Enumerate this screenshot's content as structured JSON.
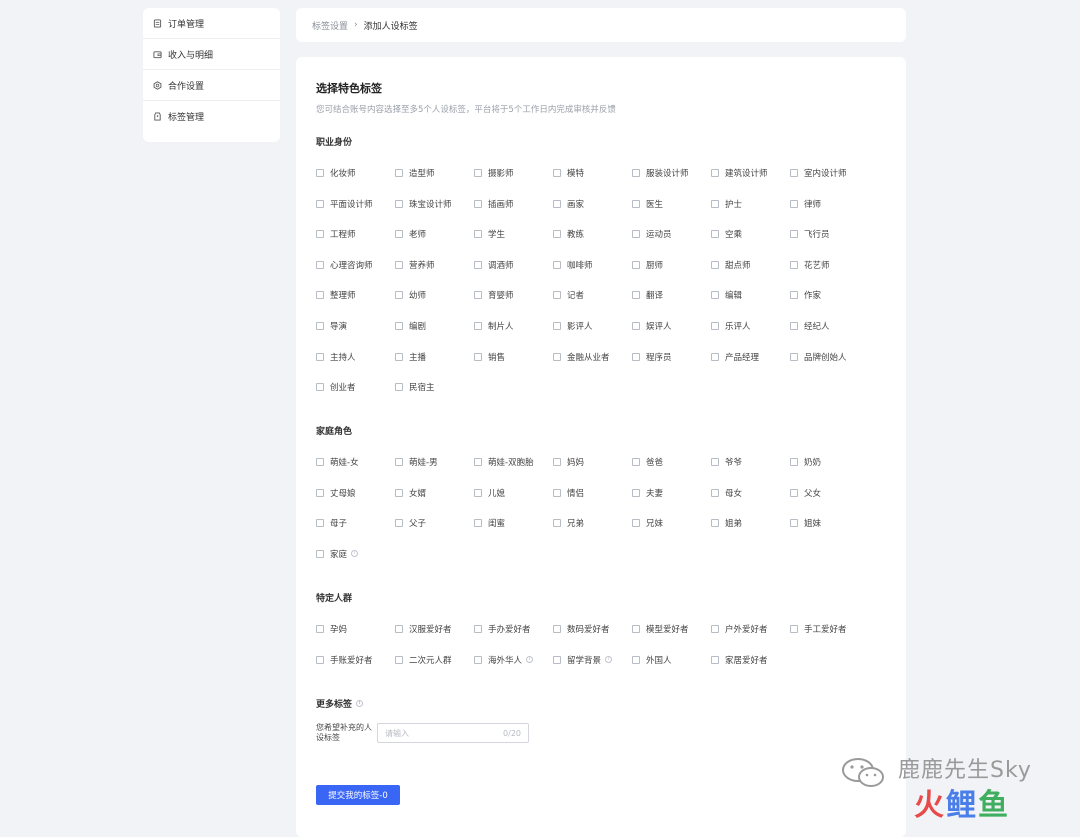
{
  "sidebar": {
    "items": [
      {
        "label": "订单管理",
        "icon": "order-icon"
      },
      {
        "label": "收入与明细",
        "icon": "wallet-icon"
      },
      {
        "label": "合作设置",
        "icon": "settings-icon"
      },
      {
        "label": "标签管理",
        "icon": "tag-icon"
      }
    ]
  },
  "breadcrumb": {
    "parent": "标签设置",
    "separator": "›",
    "current": "添加人设标签"
  },
  "main": {
    "title": "选择特色标签",
    "description": "您可结合账号内容选择至多5个人设标签，平台将于5个工作日内完成审核并反馈",
    "sections": [
      {
        "title": "职业身份",
        "options": [
          "化妆师",
          "造型师",
          "摄影师",
          "模特",
          "服装设计师",
          "建筑设计师",
          "室内设计师",
          "平面设计师",
          "珠宝设计师",
          "插画师",
          "画家",
          "医生",
          "护士",
          "律师",
          "工程师",
          "老师",
          "学生",
          "教练",
          "运动员",
          "空乘",
          "飞行员",
          "心理咨询师",
          "营养师",
          "调酒师",
          "咖啡师",
          "厨师",
          "甜点师",
          "花艺师",
          "整理师",
          "幼师",
          "育婴师",
          "记者",
          "翻译",
          "编辑",
          "作家",
          "导演",
          "编剧",
          "制片人",
          "影评人",
          "娱评人",
          "乐评人",
          "经纪人",
          "主持人",
          "主播",
          "销售",
          "金融从业者",
          "程序员",
          "产品经理",
          "品牌创始人",
          "创业者",
          "民宿主"
        ]
      },
      {
        "title": "家庭角色",
        "options": [
          "萌娃-女",
          "萌娃-男",
          "萌娃-双胞胎",
          "妈妈",
          "爸爸",
          "爷爷",
          "奶奶",
          "丈母娘",
          "女婿",
          "儿媳",
          "情侣",
          "夫妻",
          "母女",
          "父女",
          "母子",
          "父子",
          "闺蜜",
          "兄弟",
          "兄妹",
          "姐弟",
          "姐妹",
          "家庭"
        ]
      },
      {
        "title": "特定人群",
        "options": [
          "孕妈",
          "汉服爱好者",
          "手办爱好者",
          "数码爱好者",
          "模型爱好者",
          "户外爱好者",
          "手工爱好者",
          "手账爱好者",
          "二次元人群",
          "海外华人",
          "留学背景",
          "外国人",
          "家居爱好者"
        ]
      }
    ],
    "more": {
      "title": "更多标签",
      "label": "您希望补充的人设标签",
      "placeholder": "请输入",
      "counter": "0/20"
    },
    "submit_label": "提交我的标签-0"
  },
  "watermark": {
    "top": "鹿鹿先生Sky",
    "bottom_1": "火",
    "bottom_2": "鲤",
    "bottom_3": "鱼"
  },
  "colors": {
    "accent": "#3a66f5",
    "background": "#f2f3f7"
  }
}
